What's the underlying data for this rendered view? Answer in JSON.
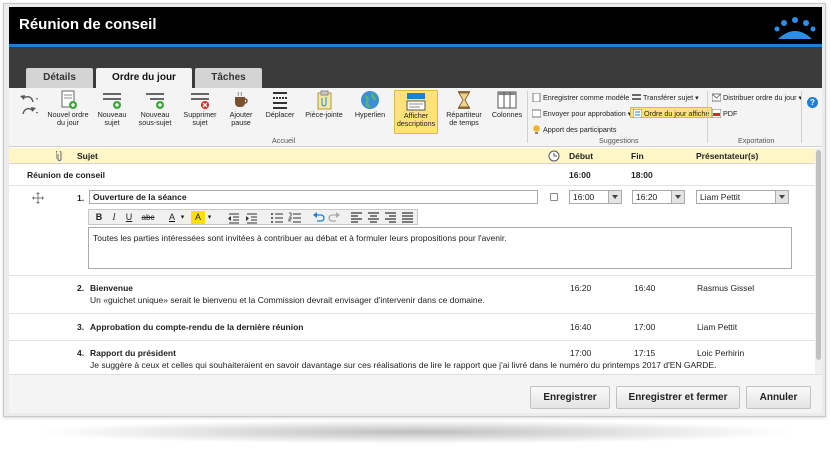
{
  "window": {
    "title": "Réunion de conseil"
  },
  "tabs": [
    {
      "label": "Détails"
    },
    {
      "label": "Ordre du jour"
    },
    {
      "label": "Tâches"
    }
  ],
  "ribbon": {
    "buttons": {
      "new_agenda": "Nouvel ordre du jour",
      "new_item": "Nouveau sujet",
      "new_subitem": "Nouveau sous-sujet",
      "delete_item": "Supprimer sujet",
      "add_break": "Ajouter pause",
      "move": "Déplacer",
      "attachment": "Pièce-jointe",
      "hyperlink": "Hyperlien",
      "show_descriptions": "Afficher descriptions",
      "distribute_time": "Répartiteur de temps",
      "columns": "Colonnes"
    },
    "group_labels": {
      "accueil": "Accueil",
      "suggestions": "Suggestions",
      "exportation": "Exportation"
    },
    "suggestions": {
      "save_template": "Enregistrer comme modèle",
      "transfer_item": "Transférer sujet",
      "send_approval": "Envoyer pour approbation",
      "agenda_shown": "Ordre du jour affiché",
      "participant_input": "Apport des participants"
    },
    "export": {
      "distribute": "Distribuer ordre du jour",
      "pdf": "PDF"
    },
    "help": "?"
  },
  "columns": {
    "subject": "Sujet",
    "start": "Début",
    "end": "Fin",
    "presenter": "Présentateur(s)"
  },
  "meeting": {
    "name": "Réunion de conseil",
    "start": "16:00",
    "end": "18:00"
  },
  "items": [
    {
      "number": "1.",
      "title": "Ouverture de la séance",
      "start": "16:00",
      "end": "16:20",
      "presenter": "Liam Pettit",
      "description": "Toutes les parties intéressées sont invitées à contribuer au débat et à formuler leurs propositions pour l'avenir."
    },
    {
      "number": "2.",
      "title": "Bienvenue",
      "description": "Un «guichet unique» serait le bienvenu et la Commission devrait envisager d'intervenir dans ce domaine.",
      "start": "16:20",
      "end": "16:40",
      "presenter": "Rasmus Gissel"
    },
    {
      "number": "3.",
      "title": "Approbation du compte-rendu de la dernière réunion",
      "description": "",
      "start": "16:40",
      "end": "17:00",
      "presenter": "Liam Pettit"
    },
    {
      "number": "4.",
      "title": "Rapport du président",
      "description": "Je suggère à ceux et celles qui souhaiteraient en savoir davantage sur ces réalisations de lire le rapport que j'ai livré dans le numéro du printemps 2017 d'EN GARDE.",
      "start": "17:00",
      "end": "17:15",
      "presenter": "Loic Perhirin"
    }
  ],
  "editor": {
    "bold": "B",
    "italic": "I",
    "underline": "U",
    "strike": "abc",
    "font_color": "A",
    "highlight": "A"
  },
  "footer": {
    "save": "Enregistrer",
    "save_close": "Enregistrer et fermer",
    "cancel": "Annuler"
  }
}
